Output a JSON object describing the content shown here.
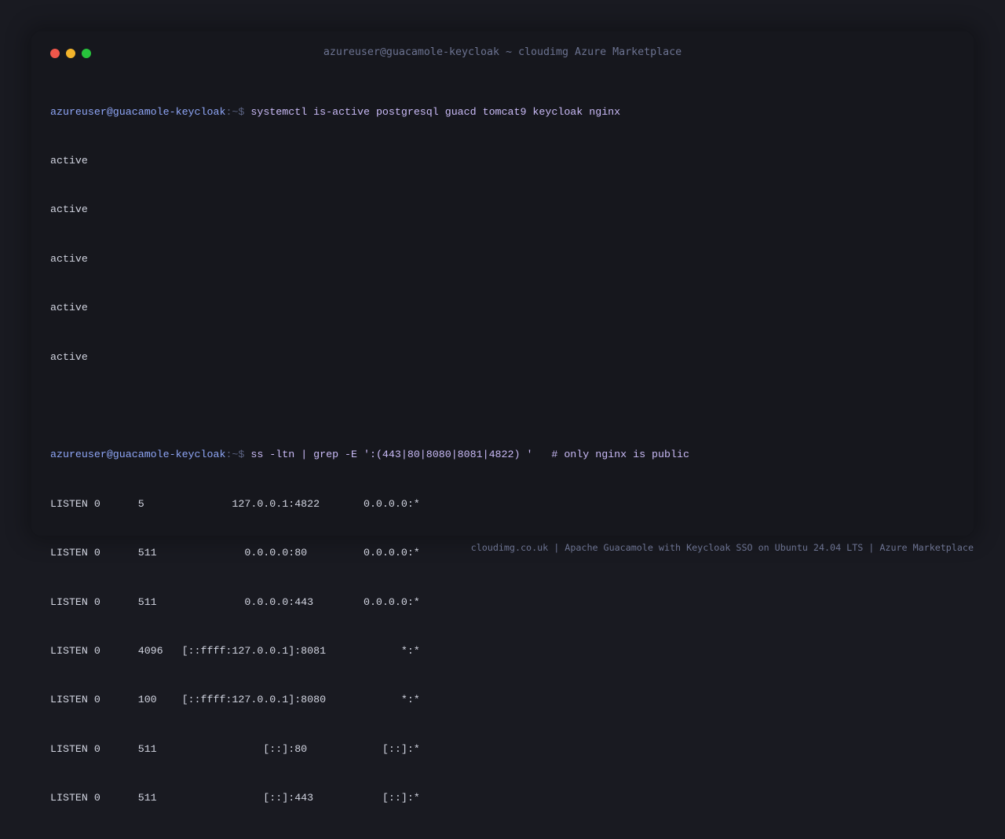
{
  "window": {
    "title": "azureuser@guacamole-keycloak ~ cloudimg Azure Marketplace"
  },
  "terminal": {
    "prompt_user_host": "azureuser@guacamole-keycloak",
    "prompt_suffix": ":~$ ",
    "command1": "systemctl is-active postgresql guacd tomcat9 keycloak nginx",
    "output1": [
      "active",
      "active",
      "active",
      "active",
      "active"
    ],
    "command2": "ss -ltn | grep -E ':(443|80|8080|8081|4822) '   # only nginx is public",
    "output2": [
      "LISTEN 0      5              127.0.0.1:4822       0.0.0.0:*",
      "LISTEN 0      511              0.0.0.0:80         0.0.0.0:*",
      "LISTEN 0      511              0.0.0.0:443        0.0.0.0:*",
      "LISTEN 0      4096   [::ffff:127.0.0.1]:8081            *:*",
      "LISTEN 0      100    [::ffff:127.0.0.1]:8080            *:*",
      "LISTEN 0      511                 [::]:80            [::]:*",
      "LISTEN 0      511                 [::]:443           [::]:*"
    ]
  },
  "footer": {
    "text": "cloudimg.co.uk | Apache Guacamole with Keycloak SSO on Ubuntu 24.04 LTS | Azure Marketplace"
  },
  "colors": {
    "background": "#191a21",
    "window": "#16171d",
    "close": "#f1574b",
    "minimize": "#f3b42b",
    "maximize": "#27c33c",
    "prompt": "#8fa6f7",
    "command": "#c9baf6",
    "output": "#d2d5e1"
  }
}
